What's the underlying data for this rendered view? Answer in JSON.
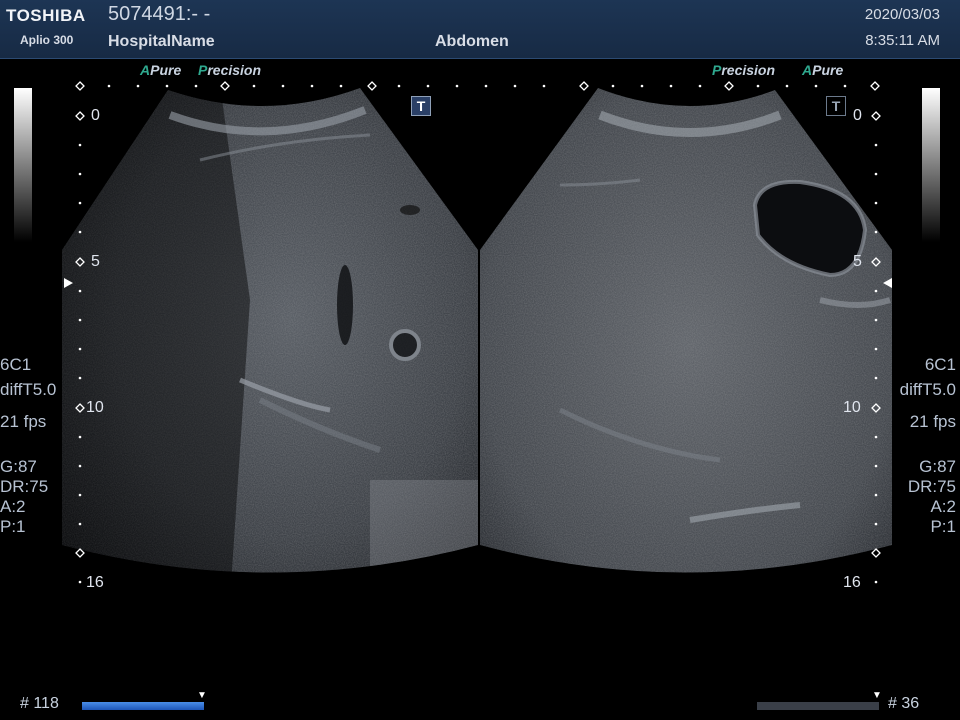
{
  "header": {
    "brand": "TOSHIBA",
    "model": "Aplio 300",
    "patient_id": "5074491:- -",
    "hospital": "HospitalName",
    "exam": "Abdomen",
    "date": "2020/03/03",
    "time": "8:35:11 AM"
  },
  "labels": {
    "left_tag_a": "A",
    "left_tag_pure": "Pure",
    "left_tag_p": "P",
    "left_tag_recision": "recision",
    "right_tag_p": "P",
    "right_tag_recision": "recision",
    "right_tag_a": "A",
    "right_tag_pure": "Pure",
    "t_icon": "T"
  },
  "depth_scale": {
    "d0": "0",
    "d5": "5",
    "d10": "10",
    "d16": "16"
  },
  "left_panel": {
    "probe": "6C1",
    "filter": "diffT5.0",
    "fps": "21 fps",
    "gain": "G:87",
    "dynamic_range": "DR:75",
    "a": "A:2",
    "p": "P:1"
  },
  "right_panel": {
    "probe": "6C1",
    "filter": "diffT5.0",
    "fps": "21 fps",
    "gain": "G:87",
    "dynamic_range": "DR:75",
    "a": "A:2",
    "p": "P:1"
  },
  "footer": {
    "left_frame": "# 118",
    "right_frame": "# 36",
    "left_progress": 1.0,
    "right_progress": 1.0
  },
  "colors": {
    "header_bg": "#1d3554",
    "accent_teal": "#2fa98f",
    "bar_blue": "#2f6fd0"
  }
}
